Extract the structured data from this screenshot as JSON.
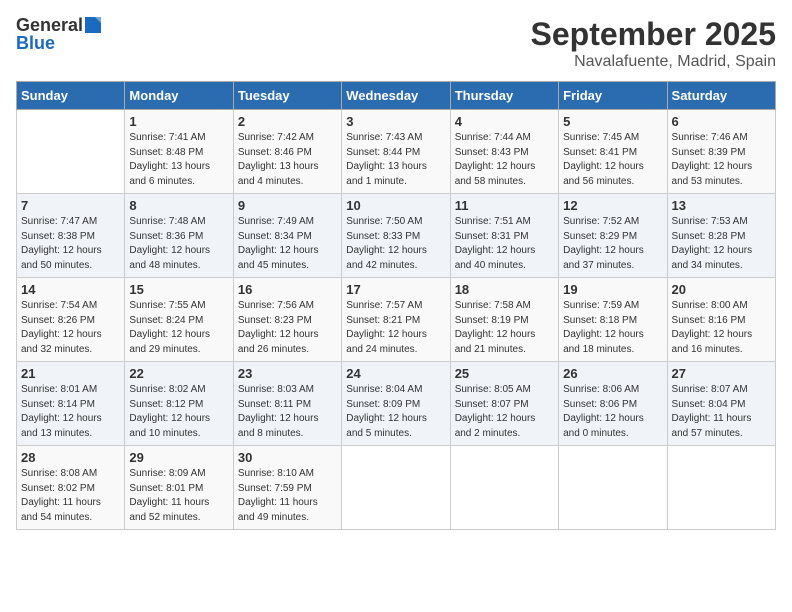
{
  "header": {
    "logo_general": "General",
    "logo_blue": "Blue",
    "title": "September 2025",
    "subtitle": "Navalafuente, Madrid, Spain"
  },
  "days_of_week": [
    "Sunday",
    "Monday",
    "Tuesday",
    "Wednesday",
    "Thursday",
    "Friday",
    "Saturday"
  ],
  "weeks": [
    [
      {
        "num": "",
        "info": ""
      },
      {
        "num": "1",
        "info": "Sunrise: 7:41 AM\nSunset: 8:48 PM\nDaylight: 13 hours\nand 6 minutes."
      },
      {
        "num": "2",
        "info": "Sunrise: 7:42 AM\nSunset: 8:46 PM\nDaylight: 13 hours\nand 4 minutes."
      },
      {
        "num": "3",
        "info": "Sunrise: 7:43 AM\nSunset: 8:44 PM\nDaylight: 13 hours\nand 1 minute."
      },
      {
        "num": "4",
        "info": "Sunrise: 7:44 AM\nSunset: 8:43 PM\nDaylight: 12 hours\nand 58 minutes."
      },
      {
        "num": "5",
        "info": "Sunrise: 7:45 AM\nSunset: 8:41 PM\nDaylight: 12 hours\nand 56 minutes."
      },
      {
        "num": "6",
        "info": "Sunrise: 7:46 AM\nSunset: 8:39 PM\nDaylight: 12 hours\nand 53 minutes."
      }
    ],
    [
      {
        "num": "7",
        "info": "Sunrise: 7:47 AM\nSunset: 8:38 PM\nDaylight: 12 hours\nand 50 minutes."
      },
      {
        "num": "8",
        "info": "Sunrise: 7:48 AM\nSunset: 8:36 PM\nDaylight: 12 hours\nand 48 minutes."
      },
      {
        "num": "9",
        "info": "Sunrise: 7:49 AM\nSunset: 8:34 PM\nDaylight: 12 hours\nand 45 minutes."
      },
      {
        "num": "10",
        "info": "Sunrise: 7:50 AM\nSunset: 8:33 PM\nDaylight: 12 hours\nand 42 minutes."
      },
      {
        "num": "11",
        "info": "Sunrise: 7:51 AM\nSunset: 8:31 PM\nDaylight: 12 hours\nand 40 minutes."
      },
      {
        "num": "12",
        "info": "Sunrise: 7:52 AM\nSunset: 8:29 PM\nDaylight: 12 hours\nand 37 minutes."
      },
      {
        "num": "13",
        "info": "Sunrise: 7:53 AM\nSunset: 8:28 PM\nDaylight: 12 hours\nand 34 minutes."
      }
    ],
    [
      {
        "num": "14",
        "info": "Sunrise: 7:54 AM\nSunset: 8:26 PM\nDaylight: 12 hours\nand 32 minutes."
      },
      {
        "num": "15",
        "info": "Sunrise: 7:55 AM\nSunset: 8:24 PM\nDaylight: 12 hours\nand 29 minutes."
      },
      {
        "num": "16",
        "info": "Sunrise: 7:56 AM\nSunset: 8:23 PM\nDaylight: 12 hours\nand 26 minutes."
      },
      {
        "num": "17",
        "info": "Sunrise: 7:57 AM\nSunset: 8:21 PM\nDaylight: 12 hours\nand 24 minutes."
      },
      {
        "num": "18",
        "info": "Sunrise: 7:58 AM\nSunset: 8:19 PM\nDaylight: 12 hours\nand 21 minutes."
      },
      {
        "num": "19",
        "info": "Sunrise: 7:59 AM\nSunset: 8:18 PM\nDaylight: 12 hours\nand 18 minutes."
      },
      {
        "num": "20",
        "info": "Sunrise: 8:00 AM\nSunset: 8:16 PM\nDaylight: 12 hours\nand 16 minutes."
      }
    ],
    [
      {
        "num": "21",
        "info": "Sunrise: 8:01 AM\nSunset: 8:14 PM\nDaylight: 12 hours\nand 13 minutes."
      },
      {
        "num": "22",
        "info": "Sunrise: 8:02 AM\nSunset: 8:12 PM\nDaylight: 12 hours\nand 10 minutes."
      },
      {
        "num": "23",
        "info": "Sunrise: 8:03 AM\nSunset: 8:11 PM\nDaylight: 12 hours\nand 8 minutes."
      },
      {
        "num": "24",
        "info": "Sunrise: 8:04 AM\nSunset: 8:09 PM\nDaylight: 12 hours\nand 5 minutes."
      },
      {
        "num": "25",
        "info": "Sunrise: 8:05 AM\nSunset: 8:07 PM\nDaylight: 12 hours\nand 2 minutes."
      },
      {
        "num": "26",
        "info": "Sunrise: 8:06 AM\nSunset: 8:06 PM\nDaylight: 12 hours\nand 0 minutes."
      },
      {
        "num": "27",
        "info": "Sunrise: 8:07 AM\nSunset: 8:04 PM\nDaylight: 11 hours\nand 57 minutes."
      }
    ],
    [
      {
        "num": "28",
        "info": "Sunrise: 8:08 AM\nSunset: 8:02 PM\nDaylight: 11 hours\nand 54 minutes."
      },
      {
        "num": "29",
        "info": "Sunrise: 8:09 AM\nSunset: 8:01 PM\nDaylight: 11 hours\nand 52 minutes."
      },
      {
        "num": "30",
        "info": "Sunrise: 8:10 AM\nSunset: 7:59 PM\nDaylight: 11 hours\nand 49 minutes."
      },
      {
        "num": "",
        "info": ""
      },
      {
        "num": "",
        "info": ""
      },
      {
        "num": "",
        "info": ""
      },
      {
        "num": "",
        "info": ""
      }
    ]
  ]
}
